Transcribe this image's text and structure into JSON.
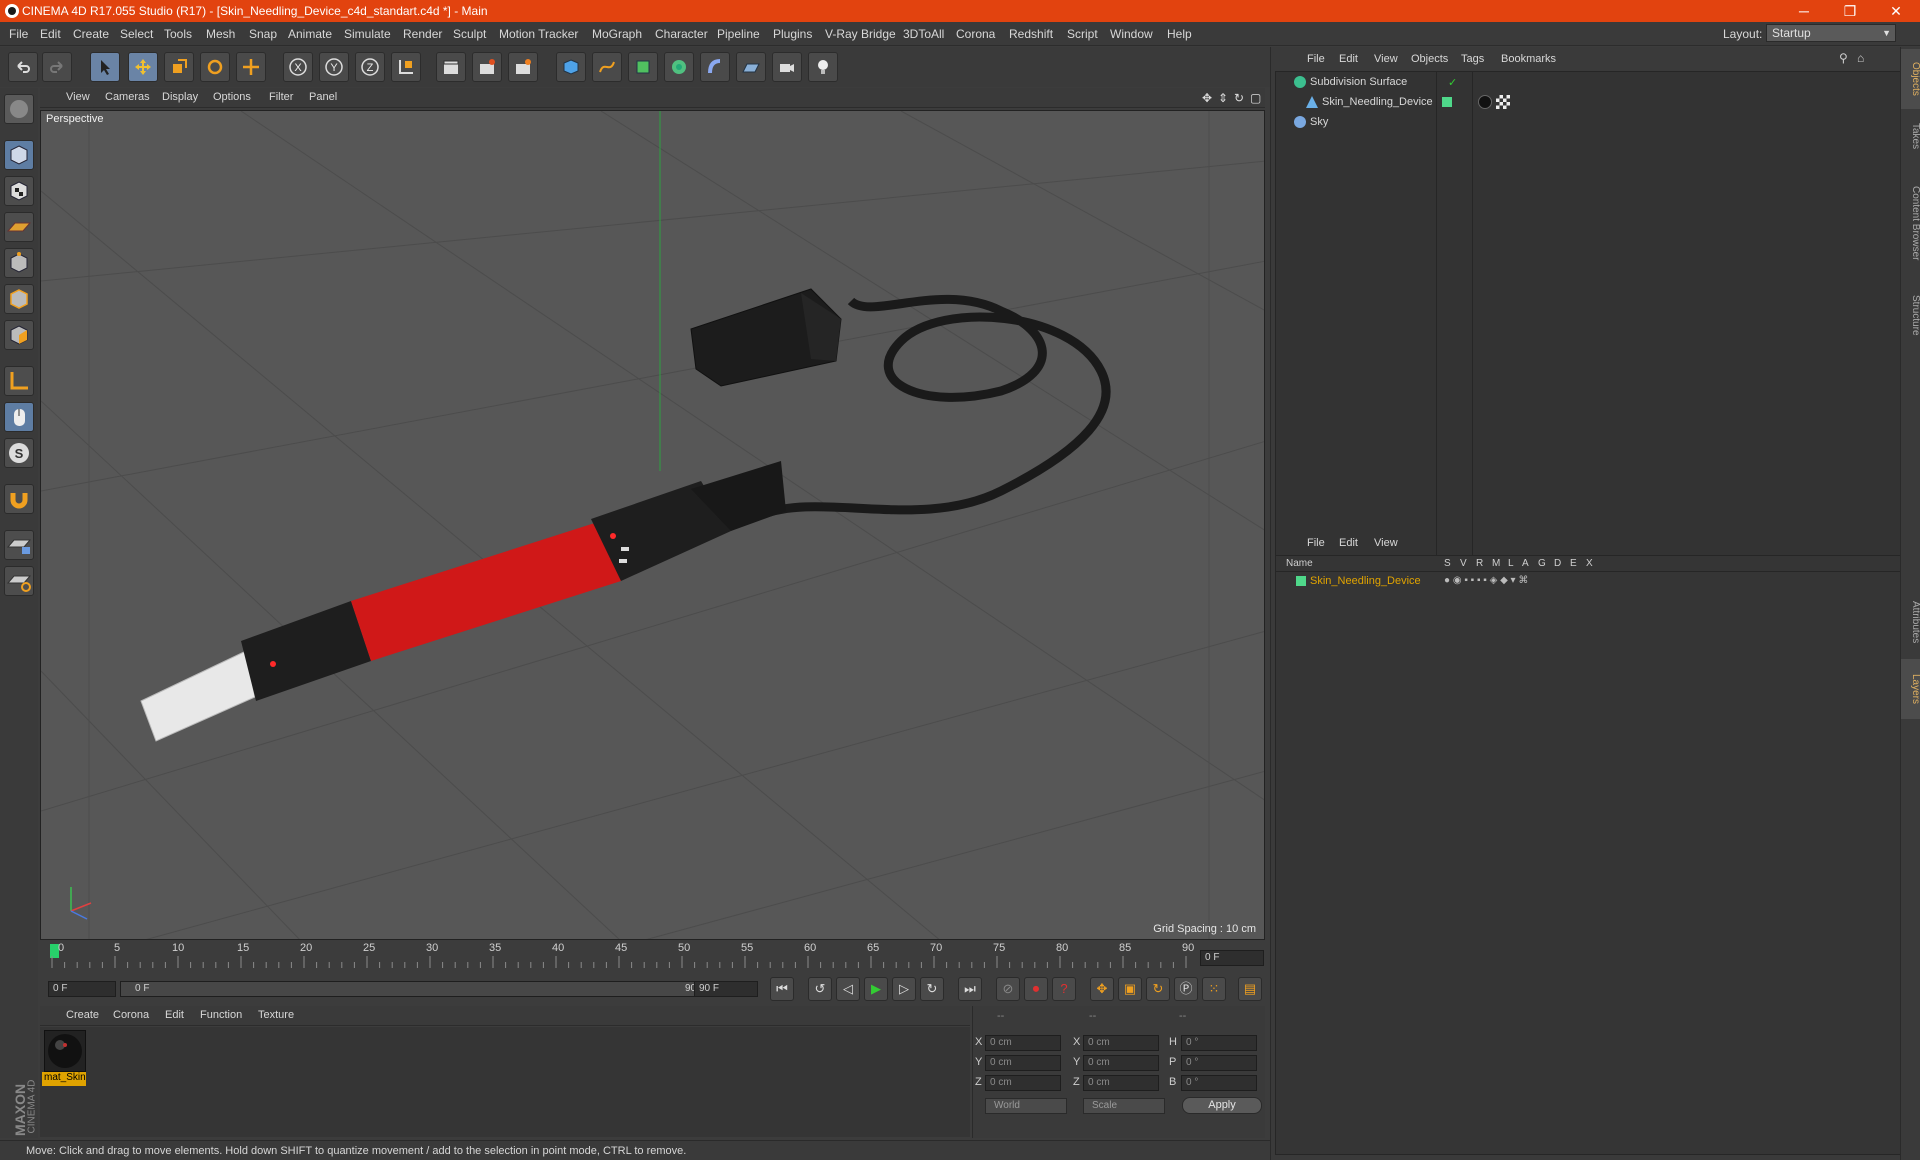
{
  "window": {
    "title": "CINEMA 4D R17.055 Studio (R17) - [Skin_Needling_Device_c4d_standart.c4d *] - Main",
    "min": "─",
    "max": "❐",
    "close": "✕"
  },
  "menubar": {
    "items": [
      "File",
      "Edit",
      "Create",
      "Select",
      "Tools",
      "Mesh",
      "Snap",
      "Animate",
      "Simulate",
      "Render",
      "Sculpt",
      "Motion Tracker",
      "MoGraph",
      "Character",
      "Pipeline",
      "Plugins",
      "V-Ray Bridge",
      "3DToAll",
      "Corona",
      "Redshift",
      "Script",
      "Window",
      "Help"
    ],
    "layout_label": "Layout:",
    "layout_value": "Startup"
  },
  "viewport": {
    "menu": [
      "View",
      "Cameras",
      "Display",
      "Options",
      "Filter",
      "Panel"
    ],
    "camera_label": "Perspective",
    "grid_spacing": "Grid Spacing : 10 cm"
  },
  "timeline": {
    "ticks": [
      "0",
      "5",
      "10",
      "15",
      "20",
      "25",
      "30",
      "35",
      "40",
      "45",
      "50",
      "55",
      "60",
      "65",
      "70",
      "75",
      "80",
      "85",
      "90"
    ],
    "current_frame": "0 F",
    "start_field": "0 F",
    "range_start": "0 F",
    "range_end": "90 F",
    "end_field": "90 F"
  },
  "material_manager": {
    "menu": [
      "Create",
      "Corona",
      "Edit",
      "Function",
      "Texture"
    ],
    "materials": [
      {
        "name": "mat_Skin"
      }
    ]
  },
  "coordinates": {
    "headers": [
      "--",
      "--",
      "--"
    ],
    "rows": [
      {
        "a": "X",
        "pos": "0 cm",
        "b": "X",
        "size": "0 cm",
        "c": "H",
        "rot": "0 °"
      },
      {
        "a": "Y",
        "pos": "0 cm",
        "b": "Y",
        "size": "0 cm",
        "c": "P",
        "rot": "0 °"
      },
      {
        "a": "Z",
        "pos": "0 cm",
        "b": "Z",
        "size": "0 cm",
        "c": "B",
        "rot": "0 °"
      }
    ],
    "mode": "World",
    "size_mode": "Scale",
    "apply": "Apply"
  },
  "object_manager": {
    "menu": [
      "File",
      "Edit",
      "View",
      "Objects",
      "Tags",
      "Bookmarks"
    ],
    "objects": [
      {
        "name": "Subdivision Surface"
      },
      {
        "name": "Skin_Needling_Device"
      },
      {
        "name": "Sky"
      }
    ]
  },
  "layer_manager": {
    "menu": [
      "File",
      "Edit",
      "View"
    ],
    "columns": [
      "Name",
      "S",
      "V",
      "R",
      "M",
      "L",
      "A",
      "G",
      "D",
      "E",
      "X"
    ],
    "layers": [
      {
        "name": "Skin_Needling_Device",
        "color": "#4fd88a"
      }
    ]
  },
  "side_tabs": [
    "Objects",
    "Takes",
    "Content Browser",
    "Structure",
    "Attributes",
    "Layers"
  ],
  "status": "Move: Click and drag to move elements. Hold down SHIFT to quantize movement / add to the selection in point mode, CTRL to remove.",
  "logo": {
    "line1": "MAXON",
    "line2": "CINEMA 4D"
  },
  "colors": {
    "title_bar": "#e2430f",
    "selection": "#e0a300",
    "device_red": "#d01818"
  }
}
